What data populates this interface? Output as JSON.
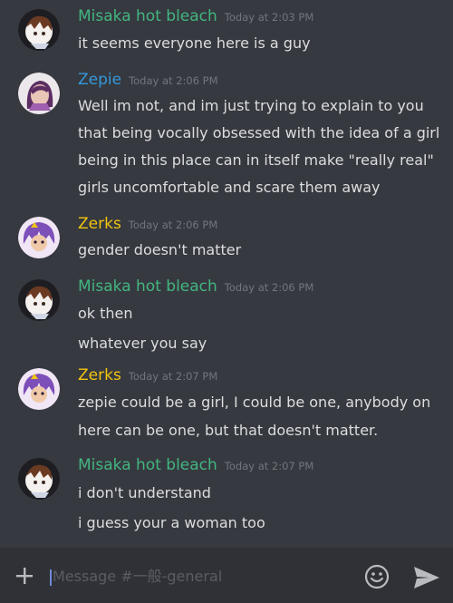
{
  "colors": {
    "background": "#36393f",
    "composer_bg": "#2f3136",
    "misaka": "#43b581",
    "zepie": "#3498db",
    "zerks": "#f1c40f",
    "text": "#dcddde",
    "timestamp": "#72767d"
  },
  "messages": [
    {
      "author": "Misaka hot bleach",
      "timestamp": "Today at 2:03 PM",
      "lines": [
        "it seems everyone here is a guy"
      ]
    },
    {
      "author": "Zepie",
      "timestamp": "Today at 2:06 PM",
      "lines": [
        "Well im not, and im just trying to explain to you",
        "that being vocally obsessed with the idea of a girl",
        "being in this place can in itself make \"really real\"",
        "girls uncomfortable and scare them away"
      ]
    },
    {
      "author": "Zerks",
      "timestamp": "Today at 2:06 PM",
      "lines": [
        "gender doesn't matter"
      ]
    },
    {
      "author": "Misaka hot bleach",
      "timestamp": "Today at 2:06 PM",
      "lines": [
        "ok then",
        "whatever you say"
      ]
    },
    {
      "author": "Zerks",
      "timestamp": "Today at 2:07 PM",
      "lines": [
        "zepie could be a girl, I could be one, anybody on",
        "here can be one, but that doesn't matter."
      ]
    },
    {
      "author": "Misaka hot bleach",
      "timestamp": "Today at 2:07 PM",
      "lines": [
        "i don't understand",
        "i guess your a woman too"
      ]
    }
  ],
  "composer": {
    "placeholder": "Message #一般-general",
    "plus_icon": "plus-icon",
    "emoji_icon": "smiley-icon",
    "send_icon": "send-icon"
  }
}
